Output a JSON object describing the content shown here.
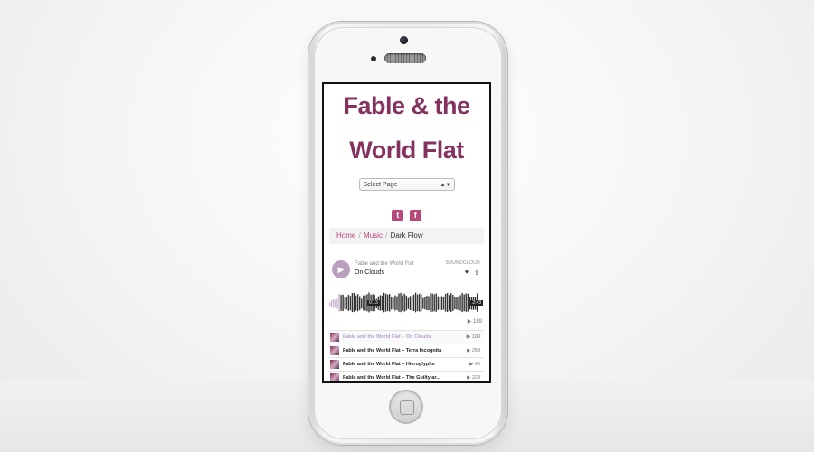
{
  "site": {
    "title_line1": "Fable & the",
    "title_line2": "World Flat"
  },
  "nav": {
    "select_value": "Select Page",
    "select_arrow": "▲▼"
  },
  "social": {
    "items": [
      {
        "icon": "twitter-icon",
        "glyph": "t"
      },
      {
        "icon": "facebook-icon",
        "glyph": "f"
      }
    ]
  },
  "breadcrumb": {
    "home": "Home",
    "sep": "/",
    "music": "Music",
    "current": "Dark Flow"
  },
  "player": {
    "artist": "Fable and the World Flat",
    "track": "On Clouds",
    "logo": "SOUNDCLOUD",
    "time_current": "0:13",
    "time_total": "2:43",
    "play_count": "▶ 189",
    "progress": 0.08,
    "accent_color": "#86325f",
    "played_wave_color": "#c9b2cf",
    "unplayed_wave_color": "#333333"
  },
  "tracklist": [
    {
      "title": "Fable and the World Flat – On Clouds",
      "plays": "▶ 189",
      "extra": "⊕",
      "active": true
    },
    {
      "title": "Fable and the World Flat – Terra Incognita",
      "plays": "▶ 268",
      "active": false
    },
    {
      "title": "Fable and the World Flat – Hieroglyphs",
      "plays": "▶ 95",
      "active": false
    },
    {
      "title": "Fable and the World Flat – The Guilty ar...",
      "plays": "▶ 229",
      "active": false
    }
  ]
}
